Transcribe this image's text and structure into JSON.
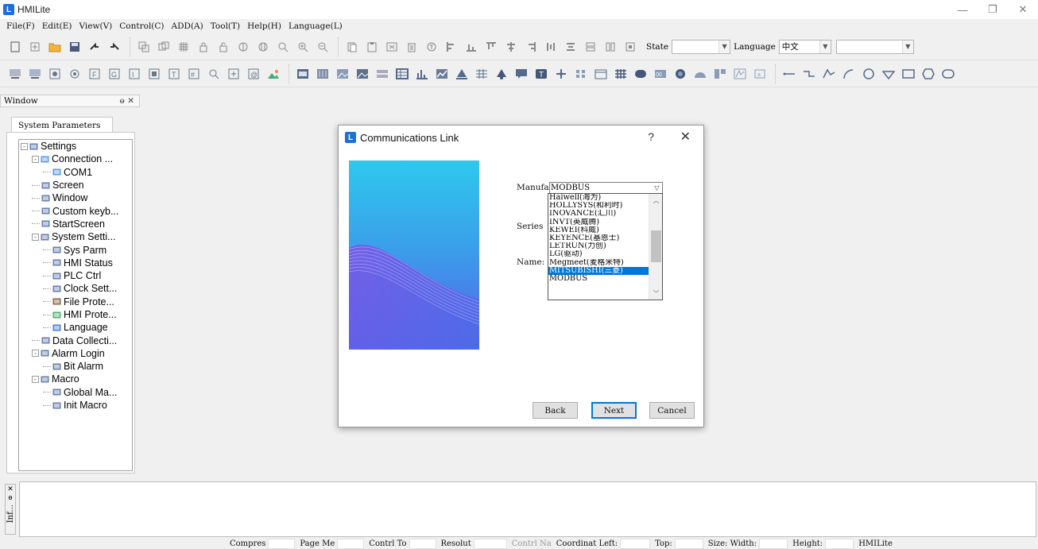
{
  "app": {
    "title": "HMILite"
  },
  "menu": [
    "File(F)",
    "Edit(E)",
    "View(V)",
    "Control(C)",
    "ADD(A)",
    "Tool(T)",
    "Help(H)",
    "Language(L)"
  ],
  "toolbar1": {
    "state_label": "State",
    "state_value": "",
    "language_label": "Language",
    "language_value": "中文",
    "extra_value": ""
  },
  "window_panel": {
    "title": "Window",
    "tab": "System Parameters",
    "tree": [
      {
        "label": "Settings",
        "depth": 0,
        "toggle": "-",
        "icon": "settings-icon"
      },
      {
        "label": "Connection ...",
        "depth": 1,
        "toggle": "-",
        "icon": "connection-icon"
      },
      {
        "label": "COM1",
        "depth": 2,
        "toggle": "",
        "icon": "com-port-icon"
      },
      {
        "label": "Screen",
        "depth": 1,
        "toggle": "",
        "icon": "screen-icon"
      },
      {
        "label": "Window",
        "depth": 1,
        "toggle": "",
        "icon": "window-icon"
      },
      {
        "label": "Custom keyb...",
        "depth": 1,
        "toggle": "",
        "icon": "keyboard-icon"
      },
      {
        "label": "StartScreen",
        "depth": 1,
        "toggle": "",
        "icon": "start-screen-icon"
      },
      {
        "label": "System Setti...",
        "depth": 1,
        "toggle": "-",
        "icon": "system-settings-icon"
      },
      {
        "label": "Sys Parm",
        "depth": 2,
        "toggle": "",
        "icon": "sys-parm-icon"
      },
      {
        "label": "HMI Status",
        "depth": 2,
        "toggle": "",
        "icon": "hmi-status-icon"
      },
      {
        "label": "PLC Ctrl",
        "depth": 2,
        "toggle": "",
        "icon": "plc-ctrl-icon"
      },
      {
        "label": "Clock Sett...",
        "depth": 2,
        "toggle": "",
        "icon": "clock-icon"
      },
      {
        "label": "File Prote...",
        "depth": 2,
        "toggle": "",
        "icon": "lock-icon"
      },
      {
        "label": "HMI Prote...",
        "depth": 2,
        "toggle": "",
        "icon": "shield-icon"
      },
      {
        "label": "Language",
        "depth": 2,
        "toggle": "",
        "icon": "globe-icon"
      },
      {
        "label": "Data Collecti...",
        "depth": 1,
        "toggle": "",
        "icon": "data-collection-icon"
      },
      {
        "label": "Alarm Login",
        "depth": 1,
        "toggle": "-",
        "icon": "alarm-icon"
      },
      {
        "label": "Bit Alarm",
        "depth": 2,
        "toggle": "",
        "icon": "bit-alarm-icon"
      },
      {
        "label": "Macro",
        "depth": 1,
        "toggle": "-",
        "icon": "macro-icon"
      },
      {
        "label": "Global Ma...",
        "depth": 2,
        "toggle": "",
        "icon": "global-macro-icon"
      },
      {
        "label": "Init Macro",
        "depth": 2,
        "toggle": "",
        "icon": "init-macro-icon"
      }
    ]
  },
  "info_panel": {
    "title": "Inf..."
  },
  "statusbar": [
    {
      "label": "Compres",
      "dim": false
    },
    {
      "label": "Page Me",
      "dim": false
    },
    {
      "label": "Contrl To",
      "dim": false
    },
    {
      "label": "Resolut",
      "dim": false
    },
    {
      "label": "Contrl Na",
      "dim": true
    },
    {
      "label": "Coordinat Left:",
      "dim": false
    },
    {
      "label": "Top:",
      "dim": false
    },
    {
      "label": "Size: Width:",
      "dim": false
    },
    {
      "label": "Height:",
      "dim": false
    },
    {
      "label": "HMILite",
      "dim": false
    }
  ],
  "dialog": {
    "title": "Communications Link",
    "help": "?",
    "close": "✕",
    "manufacturer_label": "Manufac",
    "manufacturer_value": "MODBUS",
    "series_label": "Series",
    "name_label": "Name:",
    "dropdown_items": [
      "Haiwell(海为)",
      "HOLLYSYS(和利时)",
      "INOVANCE(汇川)",
      "INVT(英威腾)",
      "KEWEI(科威)",
      "KEYENCE(基恩士)",
      "LETRUN(力创)",
      "LG(驱动)",
      "Megmeet(麦格米特)",
      "MITSUBISHI(三菱)",
      "MODBUS"
    ],
    "selected_index": 9,
    "buttons": {
      "back": "Back",
      "next": "Next",
      "cancel": "Cancel"
    }
  },
  "colors": {
    "accent": "#0078d7",
    "logo": "#1e6fd6",
    "background": "#f0f0f0"
  }
}
